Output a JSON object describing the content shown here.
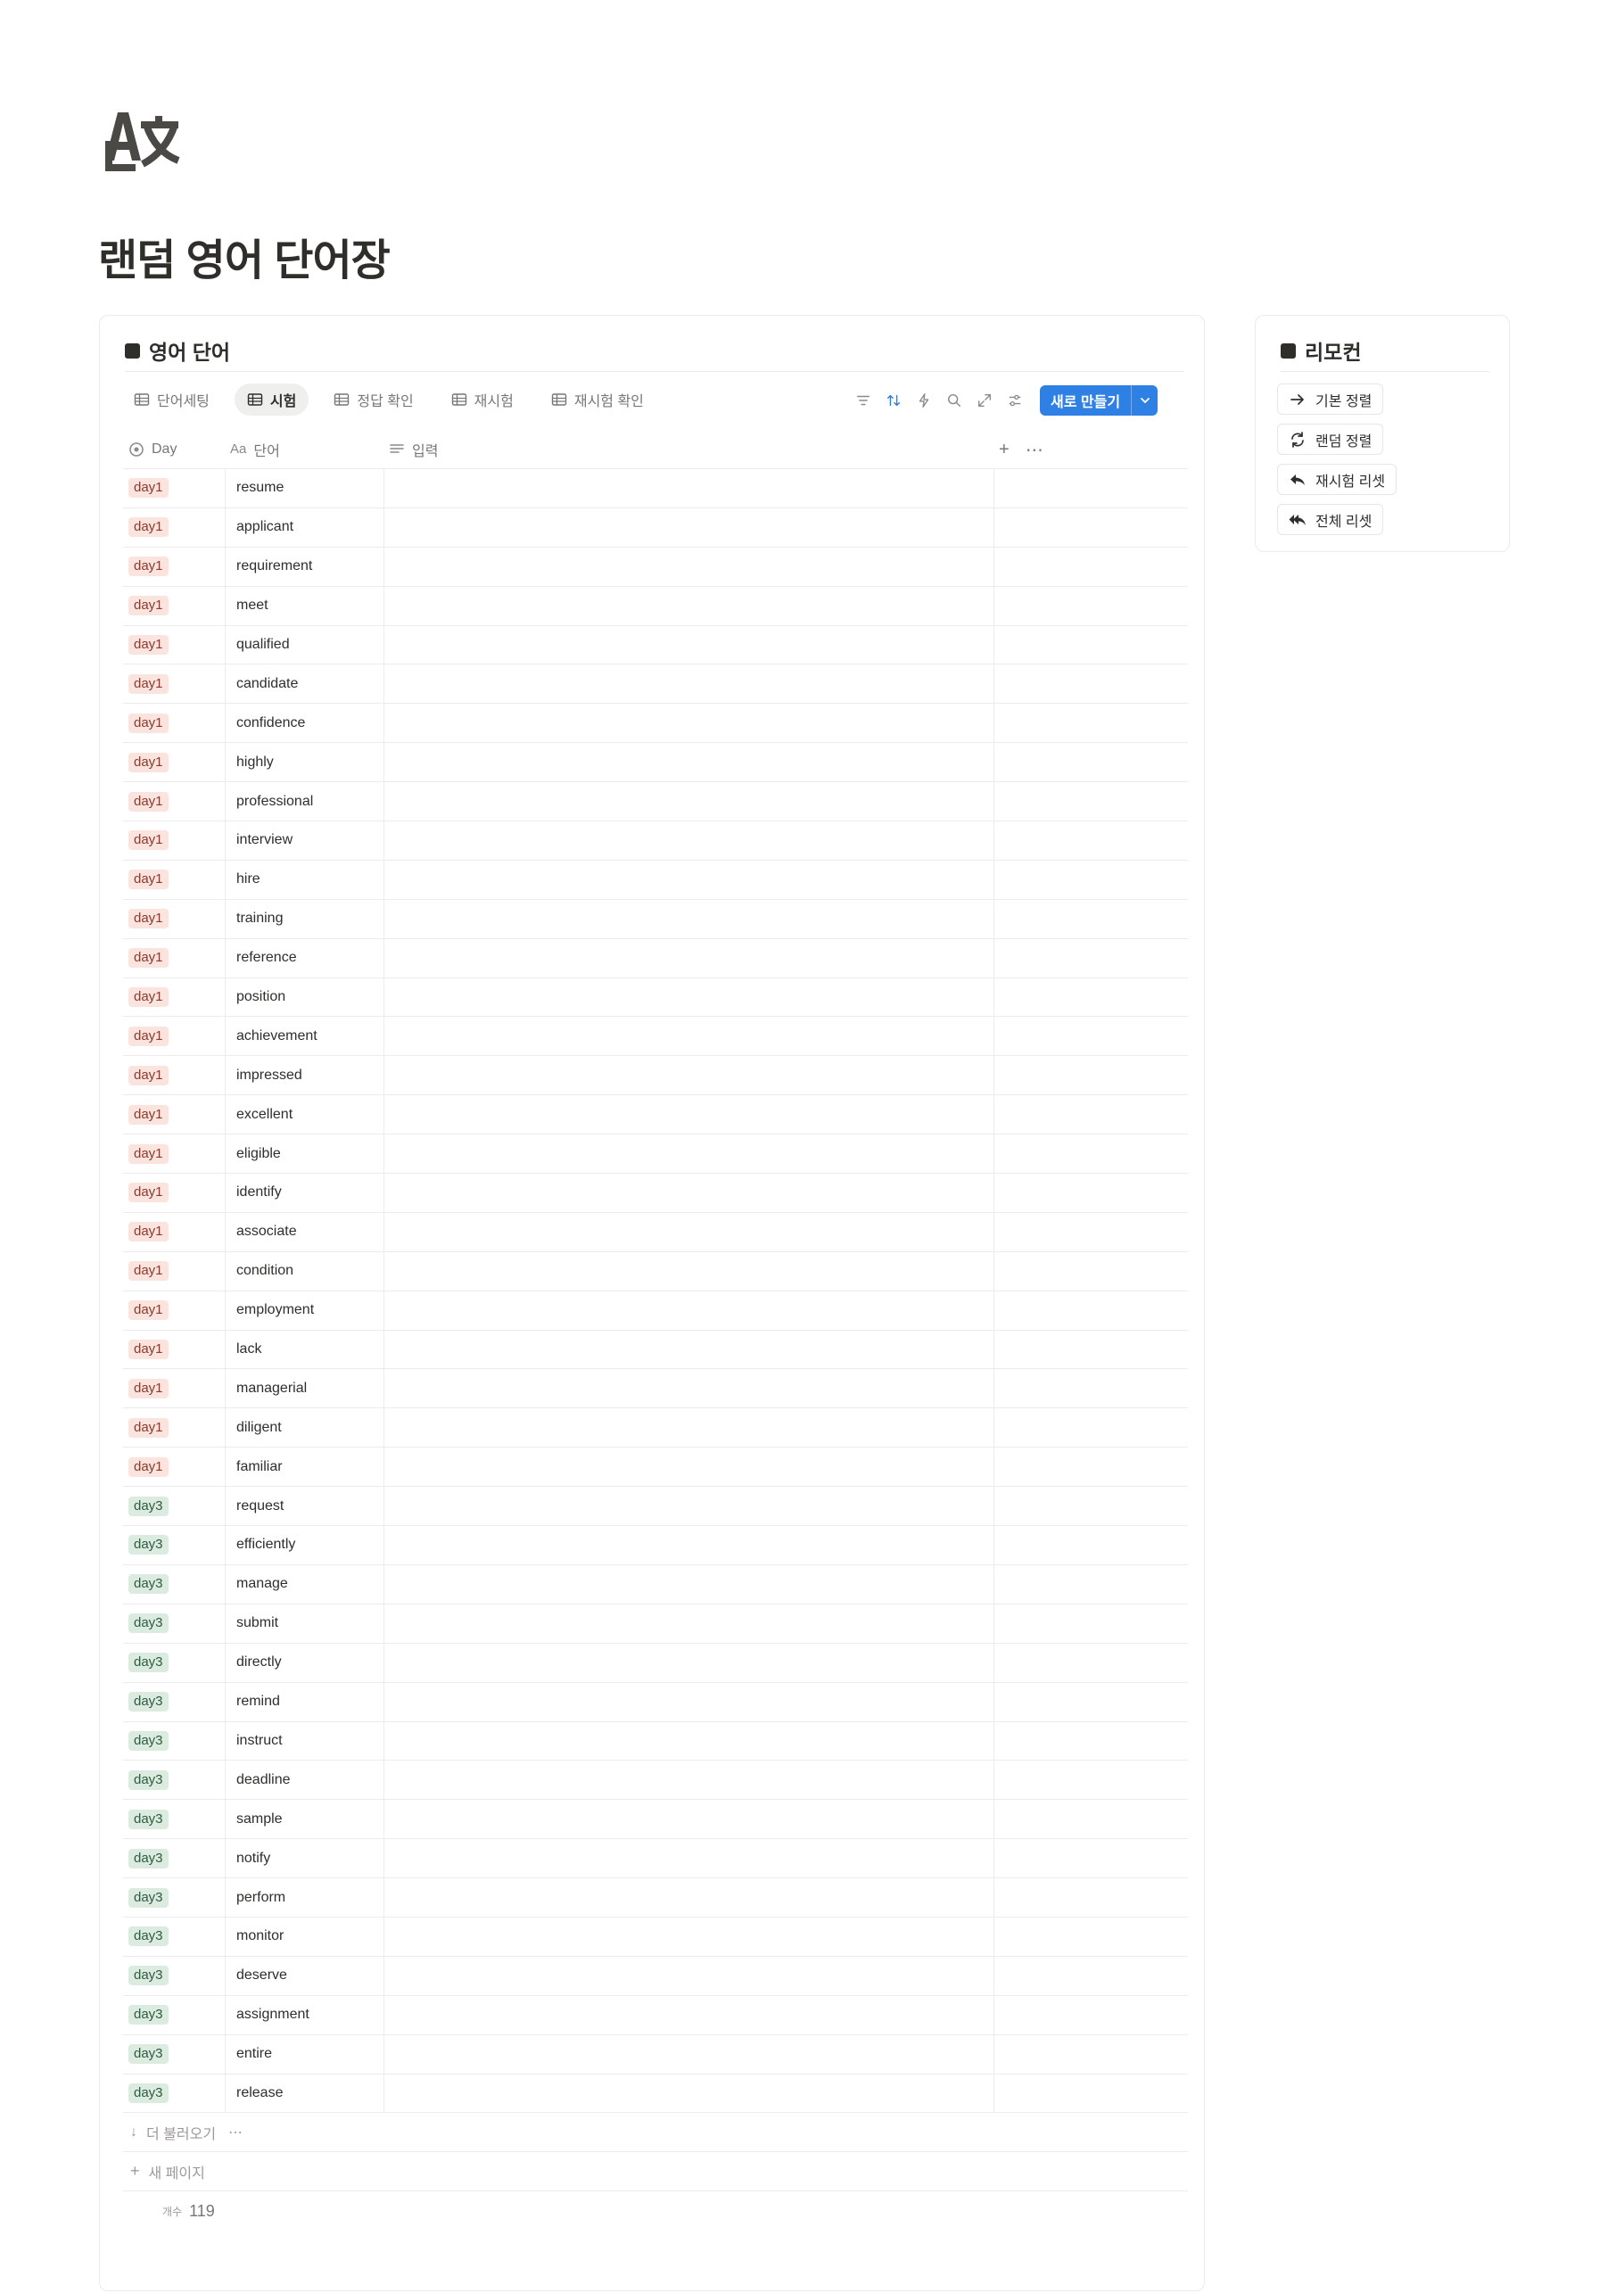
{
  "page": {
    "title": "랜덤 영어 단어장"
  },
  "main": {
    "header": "영어 단어",
    "tabs": [
      {
        "label": "단어세팅",
        "active": false
      },
      {
        "label": "시험",
        "active": true
      },
      {
        "label": "정답 확인",
        "active": false
      },
      {
        "label": "재시험",
        "active": false
      },
      {
        "label": "재시험 확인",
        "active": false
      }
    ],
    "toolbar": {
      "icons": [
        "filter-icon",
        "sort-icon",
        "lightning-icon",
        "search-icon",
        "expand-icon",
        "settings-sliders-icon"
      ],
      "new_label": "새로 만들기"
    },
    "columns": {
      "day": "Day",
      "word": "단어",
      "input": "입력"
    },
    "rows": [
      {
        "day": "day1",
        "word": "resume"
      },
      {
        "day": "day1",
        "word": "applicant"
      },
      {
        "day": "day1",
        "word": "requirement"
      },
      {
        "day": "day1",
        "word": "meet"
      },
      {
        "day": "day1",
        "word": "qualified"
      },
      {
        "day": "day1",
        "word": "candidate"
      },
      {
        "day": "day1",
        "word": "confidence"
      },
      {
        "day": "day1",
        "word": "highly"
      },
      {
        "day": "day1",
        "word": "professional"
      },
      {
        "day": "day1",
        "word": "interview"
      },
      {
        "day": "day1",
        "word": "hire"
      },
      {
        "day": "day1",
        "word": "training"
      },
      {
        "day": "day1",
        "word": "reference"
      },
      {
        "day": "day1",
        "word": "position"
      },
      {
        "day": "day1",
        "word": "achievement"
      },
      {
        "day": "day1",
        "word": "impressed"
      },
      {
        "day": "day1",
        "word": "excellent"
      },
      {
        "day": "day1",
        "word": "eligible"
      },
      {
        "day": "day1",
        "word": "identify"
      },
      {
        "day": "day1",
        "word": "associate"
      },
      {
        "day": "day1",
        "word": "condition"
      },
      {
        "day": "day1",
        "word": "employment"
      },
      {
        "day": "day1",
        "word": "lack"
      },
      {
        "day": "day1",
        "word": "managerial"
      },
      {
        "day": "day1",
        "word": "diligent"
      },
      {
        "day": "day1",
        "word": "familiar"
      },
      {
        "day": "day3",
        "word": "request"
      },
      {
        "day": "day3",
        "word": "efficiently"
      },
      {
        "day": "day3",
        "word": "manage"
      },
      {
        "day": "day3",
        "word": "submit"
      },
      {
        "day": "day3",
        "word": "directly"
      },
      {
        "day": "day3",
        "word": "remind"
      },
      {
        "day": "day3",
        "word": "instruct"
      },
      {
        "day": "day3",
        "word": "deadline"
      },
      {
        "day": "day3",
        "word": "sample"
      },
      {
        "day": "day3",
        "word": "notify"
      },
      {
        "day": "day3",
        "word": "perform"
      },
      {
        "day": "day3",
        "word": "monitor"
      },
      {
        "day": "day3",
        "word": "deserve"
      },
      {
        "day": "day3",
        "word": "assignment"
      },
      {
        "day": "day3",
        "word": "entire"
      },
      {
        "day": "day3",
        "word": "release"
      }
    ],
    "tag_colors": {
      "day1": {
        "bg": "#fbe3de",
        "fg": "#8a3a2e"
      },
      "day3": {
        "bg": "#dcebe0",
        "fg": "#2e5b3f"
      }
    },
    "load_more": "더 불러오기",
    "new_page": "새 페이지",
    "count_label": "개수",
    "count_value": "119"
  },
  "remote": {
    "header": "리모컨",
    "buttons": [
      {
        "label": "기본 정렬",
        "icon": "arrow-right-icon"
      },
      {
        "label": "랜덤 정렬",
        "icon": "refresh-icon"
      },
      {
        "label": "재시험 리셋",
        "icon": "reply-icon"
      },
      {
        "label": "전체 리셋",
        "icon": "reply-all-icon"
      }
    ]
  },
  "colors": {
    "accent": "#2f80e4",
    "text": "#37352f",
    "muted": "#787774"
  }
}
